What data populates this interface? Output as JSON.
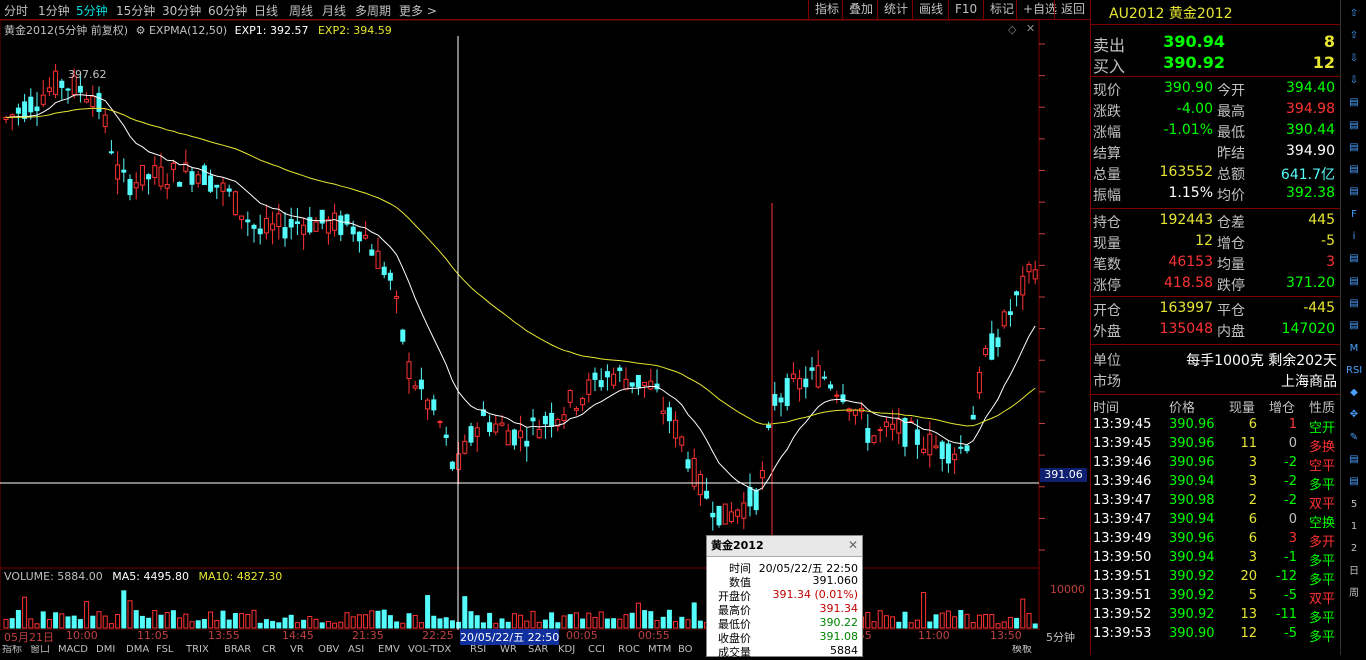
{
  "toolbar": {
    "timeframes": [
      "分时",
      "1分钟",
      "5分钟",
      "15分钟",
      "30分钟",
      "60分钟",
      "日线",
      "周线",
      "月线",
      "多周期",
      "更多 >"
    ],
    "active_timeframe": "5分钟",
    "buttons": [
      "指标",
      "叠加",
      "统计",
      "画线",
      "F10",
      "标记",
      "+自选",
      "返回"
    ]
  },
  "chart": {
    "title": "黄金2012(5分钟 前复权)",
    "indicator": "EXPMA(12,50)",
    "exp1": "EXP1: 392.57",
    "exp2": "EXP2: 394.59",
    "y_ticks": [
      "398.0",
      "397.5",
      "397.0",
      "396.5",
      "396.0",
      "395.5",
      "395.0",
      "394.5",
      "394.0",
      "393.5",
      "393.0",
      "392.5",
      "392.0",
      "391.5",
      "391.0",
      "390.5",
      "390.0"
    ],
    "crosshair_price": "391.06",
    "max_label": "397.62",
    "colors": {
      "up": "#ff3232",
      "down": "#54fcfc",
      "exp1": "#ffffff",
      "exp2": "#e6e632",
      "grid": "#800000"
    }
  },
  "volume": {
    "title": "VOLUME: 5884.00",
    "ma5": "MA5: 4495.80",
    "ma10": "MA10: 4827.30",
    "y_tick": "10000"
  },
  "x_axis": {
    "labels": [
      "05月21日",
      "10:00",
      "11:05",
      "13:55",
      "14:45",
      "21:35",
      "22:25",
      "20/05/22/五 22:50",
      "00:05",
      "00:55",
      "01:55",
      "11:00",
      "13:50"
    ],
    "period": "5分钟"
  },
  "bottom_tabs": [
    "指标",
    "窗口",
    "MACD",
    "DMI",
    "DMA",
    "FSL",
    "TRIX",
    "BRAR",
    "CR",
    "VR",
    "OBV",
    "ASI",
    "EMV",
    "VOL-TDX",
    "RSI",
    "WR",
    "SAR",
    "KDJ",
    "CCI",
    "ROC",
    "MTM",
    "BO",
    "模板"
  ],
  "tooltip": {
    "title": "黄金2012",
    "rows": [
      {
        "k": "时间",
        "v": "20/05/22/五  22:50"
      },
      {
        "k": "数值",
        "v": "391.060"
      },
      {
        "k": "开盘价",
        "v": "391.34 (0.01%)"
      },
      {
        "k": "最高价",
        "v": "391.34"
      },
      {
        "k": "最低价",
        "v": "390.22"
      },
      {
        "k": "收盘价",
        "v": "391.08"
      },
      {
        "k": "成交量",
        "v": "5884"
      }
    ]
  },
  "quote": {
    "name": "AU2012 黄金2012",
    "sell_label": "卖出",
    "sell_price": "390.94",
    "sell_qty": "8",
    "buy_label": "买入",
    "buy_price": "390.92",
    "buy_qty": "12",
    "rows1": [
      {
        "l1": "现价",
        "v1": "390.90",
        "c1": "#00ff00",
        "l2": "今开",
        "v2": "394.40",
        "c2": "#00ff00"
      },
      {
        "l1": "涨跌",
        "v1": "-4.00",
        "c1": "#00ff00",
        "l2": "最高",
        "v2": "394.98",
        "c2": "#ff3232"
      },
      {
        "l1": "涨幅",
        "v1": "-1.01%",
        "c1": "#00ff00",
        "l2": "最低",
        "v2": "390.44",
        "c2": "#00ff00"
      },
      {
        "l1": "结算",
        "v1": "",
        "c1": "#ffffff",
        "l2": "昨结",
        "v2": "394.90",
        "c2": "#ffffff"
      },
      {
        "l1": "总量",
        "v1": "163552",
        "c1": "#e6e632",
        "l2": "总额",
        "v2": "641.7亿",
        "c2": "#54fcfc"
      },
      {
        "l1": "振幅",
        "v1": "1.15%",
        "c1": "#ffffff",
        "l2": "均价",
        "v2": "392.38",
        "c2": "#00ff00"
      }
    ],
    "rows2": [
      {
        "l1": "持仓",
        "v1": "192443",
        "c1": "#e6e632",
        "l2": "仓差",
        "v2": "445",
        "c2": "#e6e632"
      },
      {
        "l1": "现量",
        "v1": "12",
        "c1": "#e6e632",
        "l2": "增仓",
        "v2": "-5",
        "c2": "#e6e632"
      },
      {
        "l1": "笔数",
        "v1": "46153",
        "c1": "#ff3232",
        "l2": "均量",
        "v2": "3",
        "c2": "#ff3232"
      },
      {
        "l1": "涨停",
        "v1": "418.58",
        "c1": "#ff3232",
        "l2": "跌停",
        "v2": "371.20",
        "c2": "#00ff00"
      }
    ],
    "rows3": [
      {
        "l1": "开仓",
        "v1": "163997",
        "c1": "#e6e632",
        "l2": "平仓",
        "v2": "-445",
        "c2": "#e6e632"
      },
      {
        "l1": "外盘",
        "v1": "135048",
        "c1": "#ff3232",
        "l2": "内盘",
        "v2": "147020",
        "c2": "#00ff00"
      }
    ],
    "unit_label": "单位",
    "unit_value": "每手1000克  剩余202天",
    "market_label": "市场",
    "market_value": "上海商品"
  },
  "ticks": {
    "headers": [
      "时间",
      "价格",
      "现量",
      "增仓",
      "性质"
    ],
    "rows": [
      {
        "t": "13:39:45",
        "p": "390.96",
        "q": "6",
        "z": "1",
        "n": "空开",
        "nc": "#00ff00"
      },
      {
        "t": "13:39:45",
        "p": "390.96",
        "q": "11",
        "z": "0",
        "n": "多换",
        "nc": "#ff3232"
      },
      {
        "t": "13:39:46",
        "p": "390.96",
        "q": "3",
        "z": "-2",
        "n": "空平",
        "nc": "#ff3232"
      },
      {
        "t": "13:39:46",
        "p": "390.94",
        "q": "3",
        "z": "-2",
        "n": "多平",
        "nc": "#00ff00"
      },
      {
        "t": "13:39:47",
        "p": "390.98",
        "q": "2",
        "z": "-2",
        "n": "双平",
        "nc": "#ff3232"
      },
      {
        "t": "13:39:47",
        "p": "390.94",
        "q": "6",
        "z": "0",
        "n": "空换",
        "nc": "#00ff00"
      },
      {
        "t": "13:39:49",
        "p": "390.96",
        "q": "6",
        "z": "3",
        "n": "多开",
        "nc": "#ff3232"
      },
      {
        "t": "13:39:50",
        "p": "390.94",
        "q": "3",
        "z": "-1",
        "n": "多平",
        "nc": "#00ff00"
      },
      {
        "t": "13:39:51",
        "p": "390.92",
        "q": "20",
        "z": "-12",
        "n": "多平",
        "nc": "#00ff00"
      },
      {
        "t": "13:39:51",
        "p": "390.92",
        "q": "5",
        "z": "-5",
        "n": "双平",
        "nc": "#ff3232"
      },
      {
        "t": "13:39:52",
        "p": "390.92",
        "q": "13",
        "z": "-11",
        "n": "多平",
        "nc": "#00ff00"
      },
      {
        "t": "13:39:53",
        "p": "390.90",
        "q": "12",
        "z": "-5",
        "n": "多平",
        "nc": "#00ff00"
      }
    ]
  },
  "side_icons": [
    "up-arrow-icon",
    "up-arrow-icon",
    "down-arrow-icon",
    "down-arrow-icon",
    "list-icon",
    "list-icon",
    "list-icon",
    "list-icon",
    "list-icon",
    "fund-icon",
    "info-icon",
    "list-icon",
    "list-icon",
    "list-icon",
    "list-icon",
    "ma-icon",
    "rsi-icon",
    "flag-icon",
    "move-icon",
    "pen-icon",
    "list-icon",
    "list-icon",
    "5-icon",
    "1-icon",
    "2-icon",
    "day-icon",
    "week-icon"
  ],
  "side_text": [
    "RSI",
    "5",
    "1",
    "2",
    "日",
    "周"
  ]
}
